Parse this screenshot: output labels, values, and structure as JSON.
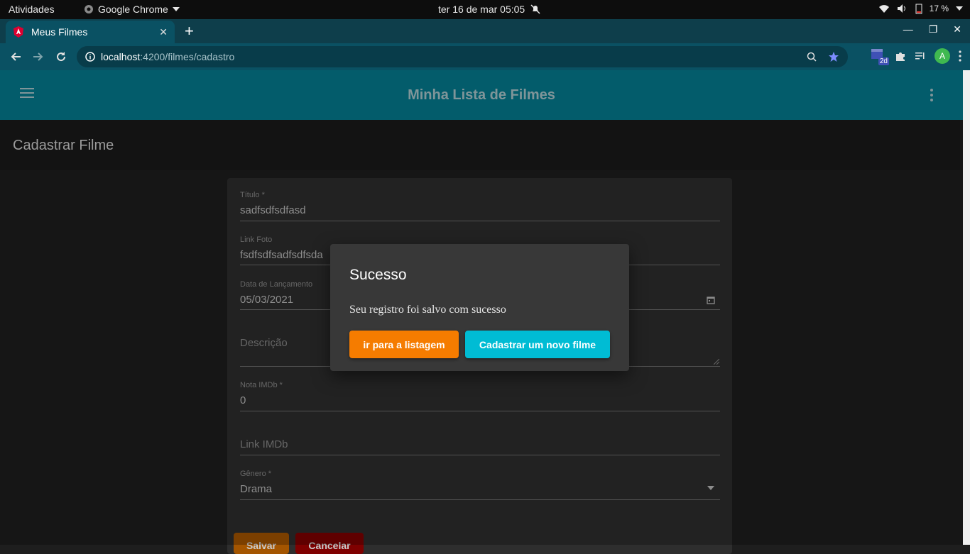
{
  "system": {
    "activities": "Atividades",
    "app_name": "Google Chrome",
    "clock": "ter 16 de mar  05:05",
    "battery": "17 %"
  },
  "browser": {
    "tab_title": "Meus Filmes",
    "url_host": "localhost",
    "url_path": ":4200/filmes/cadastro",
    "avatar_letter": "A",
    "ext_badge": "2d"
  },
  "app": {
    "title": "Minha Lista de Filmes",
    "page_title": "Cadastrar Filme"
  },
  "form": {
    "titulo": {
      "label": "Título *",
      "value": "sadfsdfsdfasd"
    },
    "link_foto": {
      "label": "Link Foto",
      "value": "fsdfsdfsadfsdfsda"
    },
    "data": {
      "label": "Data de Lançamento",
      "value": "05/03/2021"
    },
    "descricao": {
      "placeholder": "Descrição"
    },
    "nota": {
      "label": "Nota IMDb *",
      "value": "0"
    },
    "link_imdb": {
      "placeholder": "Link IMDb"
    },
    "genero": {
      "label": "Gênero *",
      "value": "Drama"
    },
    "save_label": "Salvar",
    "cancel_label": "Cancelar"
  },
  "dialog": {
    "title": "Sucesso",
    "message": "Seu registro foi salvo com sucesso",
    "list_button": "ir para a listagem",
    "new_button": "Cadastrar um novo filme"
  },
  "colors": {
    "appbar": "#047b8f",
    "list_button": "#f57c00",
    "new_button": "#00bcd4"
  }
}
